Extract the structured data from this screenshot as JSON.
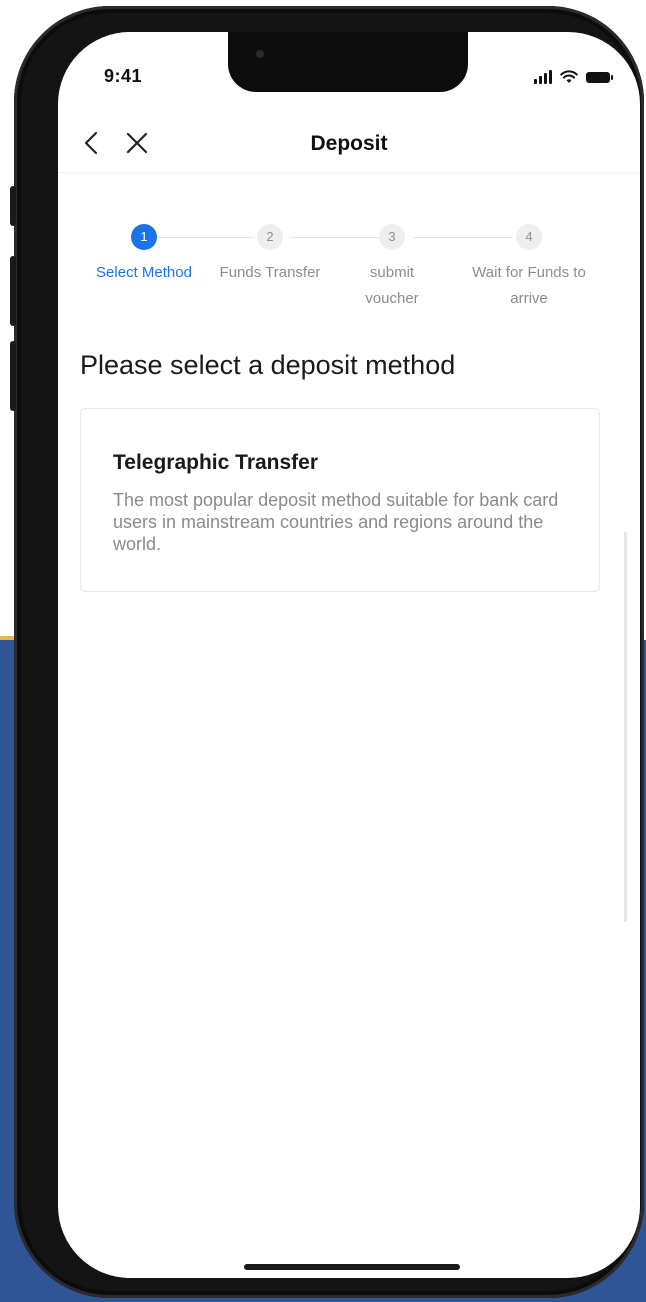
{
  "status_bar": {
    "time": "9:41",
    "icons": [
      "cellular-signal-icon",
      "wifi-icon",
      "battery-icon"
    ]
  },
  "nav": {
    "title": "Deposit",
    "back_icon": "chevron-left-icon",
    "close_icon": "close-icon"
  },
  "stepper": {
    "current_step": 1,
    "steps": [
      {
        "number": "1",
        "label": "Select Method"
      },
      {
        "number": "2",
        "label": "Funds Transfer"
      },
      {
        "number": "3",
        "label": "submit voucher"
      },
      {
        "number": "4",
        "label": "Wait for Funds to arrive"
      }
    ]
  },
  "main": {
    "section_title": "Please select a deposit method",
    "methods": [
      {
        "title": "Telegraphic Transfer",
        "description": "The most popular deposit method suitable for bank card users in mainstream countries and regions around the world."
      }
    ]
  },
  "colors": {
    "accent": "#1a73e8",
    "inactive_step": "#eeeeee",
    "muted_text": "#8a8a8a",
    "background_lower": "#2f5597"
  }
}
